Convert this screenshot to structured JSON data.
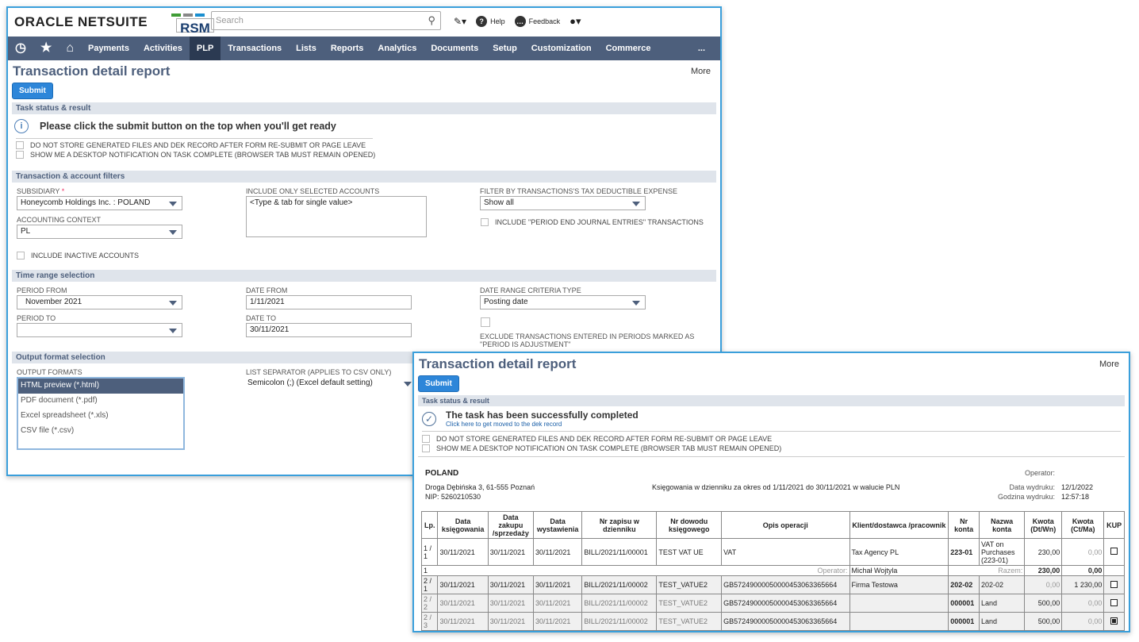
{
  "header": {
    "oracle_logo": "ORACLE NETSUITE",
    "rsm_logo": "RSM",
    "search_placeholder": "Search",
    "help": "Help",
    "feedback": "Feedback"
  },
  "nav": [
    "Payments",
    "Activities",
    "PLP",
    "Transactions",
    "Lists",
    "Reports",
    "Analytics",
    "Documents",
    "Setup",
    "Customization",
    "Commerce",
    "..."
  ],
  "nav_active": "PLP",
  "form": {
    "title": "Transaction detail report",
    "more": "More",
    "submit": "Submit",
    "sections": {
      "task": "Task status & result",
      "filters": "Transaction & account filters",
      "time": "Time range selection",
      "output": "Output format selection"
    },
    "info_message": "Please click the submit button on the top when you'll get ready",
    "chk_no_store": "DO NOT STORE GENERATED FILES AND DEK RECORD AFTER FORM RE-SUBMIT OR PAGE LEAVE",
    "chk_notify": "SHOW ME A DESKTOP NOTIFICATION ON TASK COMPLETE (BROWSER TAB MUST REMAIN OPENED)",
    "subsidiary_label": "SUBSIDIARY",
    "subsidiary_value": "Honeycomb Holdings Inc. : POLAND",
    "accounting_context_label": "ACCOUNTING CONTEXT",
    "accounting_context_value": "PL",
    "include_inactive": "INCLUDE INACTIVE ACCOUNTS",
    "include_accounts_label": "INCLUDE ONLY SELECTED ACCOUNTS",
    "include_accounts_placeholder": "<Type & tab for single value>",
    "tax_filter_label": "FILTER BY TRANSACTIONS'S TAX DEDUCTIBLE EXPENSE",
    "tax_filter_value": "Show all",
    "period_end_label": "INCLUDE \"PERIOD END JOURNAL ENTRIES\" TRANSACTIONS",
    "period_from_label": "PERIOD FROM",
    "period_from_value": "November 2021",
    "period_to_label": "PERIOD TO",
    "date_from_label": "DATE FROM",
    "date_from_value": "1/11/2021",
    "date_to_label": "DATE TO",
    "date_to_value": "30/11/2021",
    "date_criteria_label": "DATE RANGE CRITERIA TYPE",
    "date_criteria_value": "Posting date",
    "exclude_adj_label": "EXCLUDE TRANSACTIONS ENTERED IN PERIODS MARKED AS \"PERIOD IS ADJUSTMENT\"",
    "output_formats_label": "OUTPUT FORMATS",
    "output_formats": [
      "HTML preview (*.html)",
      "PDF document (*.pdf)",
      "Excel spreadsheet (*.xls)",
      "CSV file (*.csv)"
    ],
    "list_separator_label": "LIST SEPARATOR (APPLIES TO CSV ONLY)",
    "list_separator_value": "Semicolon (;) (Excel default setting)"
  },
  "result": {
    "title": "Transaction detail report",
    "more": "More",
    "submit": "Submit",
    "section": "Task status & result",
    "success": "The task has been successfully completed",
    "link": "Click here to get moved to the dek record",
    "chk_no_store": "DO NOT STORE GENERATED FILES AND DEK RECORD AFTER FORM RE-SUBMIT OR PAGE LEAVE",
    "chk_notify": "SHOW ME A DESKTOP NOTIFICATION ON TASK COMPLETE (BROWSER TAB MUST REMAIN OPENED)",
    "company": "POLAND",
    "address": "Droga Dębińska 3, 61-555 Poznań",
    "nip": "NIP: 5260210530",
    "description": "Księgowania w dzienniku za okres od 1/11/2021 do 30/11/2021 w walucie PLN",
    "operator_label": "Operator:",
    "print_date_label": "Data wydruku:",
    "print_date": "12/1/2022",
    "print_time_label": "Godzina wydruku:",
    "print_time": "12:57:18",
    "headers": [
      "Lp.",
      "Data księgowania",
      "Data zakupu /sprzedaży",
      "Data wystawienia",
      "Nr zapisu w dzienniku",
      "Nr dowodu księgowego",
      "Opis operacji",
      "Klient/dostawca /pracownik",
      "Nr konta",
      "Nazwa konta",
      "Kwota (Dt/Wn)",
      "Kwota (Ct/Ma)",
      "KUP"
    ],
    "row1": [
      "1 / 1",
      "30/11/2021",
      "30/11/2021",
      "30/11/2021",
      "BILL/2021/11/00001",
      "TEST VAT UE",
      "VAT",
      "Tax Agency PL",
      "223-01",
      "VAT on Purchases (223-01)",
      "230,00",
      "0,00"
    ],
    "sum_lp": "1",
    "sum_operator": "Operator:",
    "sum_operator_name": "Michał Wojtyla",
    "sum_label": "Razem:",
    "sum_dt": "230,00",
    "sum_ct": "0,00",
    "row2": [
      "2 / 1",
      "30/11/2021",
      "30/11/2021",
      "30/11/2021",
      "BILL/2021/11/00002",
      "TEST_VATUE2",
      "GB572490000500004530633656​64",
      "Firma Testowa",
      "202-02",
      "202-02",
      "0,00",
      "1 230,00"
    ],
    "row3": [
      "2 / 2",
      "30/11/2021",
      "30/11/2021",
      "30/11/2021",
      "BILL/2021/11/00002",
      "TEST_VATUE2",
      "GB572490000500004530633656​64",
      "",
      "000001",
      "Land",
      "500,00",
      "0,00"
    ],
    "row4": [
      "2 / 3",
      "30/11/2021",
      "30/11/2021",
      "30/11/2021",
      "BILL/2021/11/00002",
      "TEST_VATUE2",
      "GB572490000500004530633656​64",
      "",
      "000001",
      "Land",
      "500,00",
      "0,00"
    ]
  }
}
